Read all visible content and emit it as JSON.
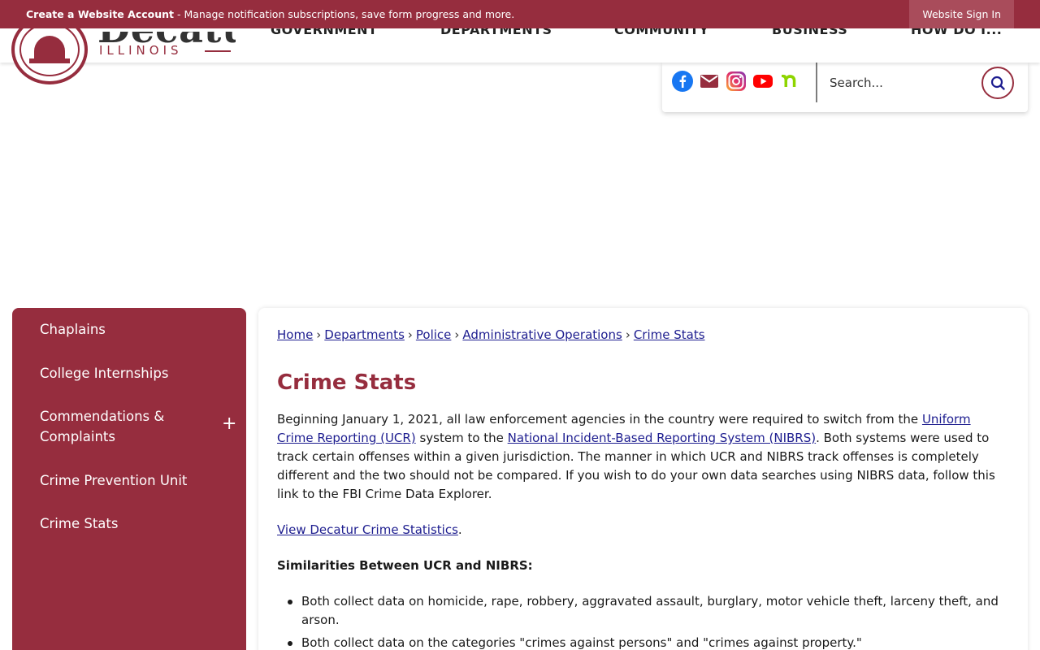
{
  "topbar": {
    "account_link": "Create a Website Account",
    "account_message": " - Manage notification subscriptions, save form progress and more.",
    "signin": "Website Sign In"
  },
  "logo": {
    "name": "Decatur",
    "subtitle": "ILLINOIS"
  },
  "nav": {
    "items": [
      "GOVERNMENT",
      "DEPARTMENTS",
      "COMMUNITY",
      "BUSINESS",
      "HOW DO I..."
    ]
  },
  "social": {
    "icons": [
      "facebook-icon",
      "email-icon",
      "instagram-icon",
      "youtube-icon",
      "nextdoor-icon"
    ],
    "colors": {
      "facebook": "#1877f2",
      "email": "#962d3e",
      "instagram": "#d6249f",
      "youtube": "#ff0000",
      "nextdoor": "#8ed500"
    }
  },
  "search": {
    "placeholder": "Search..."
  },
  "sidebar": {
    "items": [
      {
        "label": "Chaplains"
      },
      {
        "label": "College Internships"
      },
      {
        "label": "Commendations & Complaints"
      },
      {
        "label": "Crime Prevention Unit"
      },
      {
        "label": "Crime Stats"
      }
    ],
    "expand_symbol": "+"
  },
  "breadcrumb": [
    "Home",
    "Departments",
    "Police",
    "Administrative Operations",
    "Crime Stats"
  ],
  "page": {
    "title": "Crime Stats",
    "intro_1": "Beginning January 1, 2021, all law enforcement agencies in the country were required to switch from the ",
    "ucr_link": "Uniform Crime Reporting (UCR)",
    "intro_2": " system to the ",
    "nibrs_link": "National Incident-Based Reporting System (NIBRS)",
    "intro_3": ". Both systems were used to track certain offenses within a given jurisdiction. The manner in which UCR and NIBRS track offenses is completely different and the two should not be compared. If you wish to do your own data searches using NIBRS data, follow this link to the FBI Crime Data Explorer.",
    "view_link": "View Decatur Crime Statistics",
    "view_period": ".",
    "similarities_heading": "Similarities Between UCR and NIBRS:",
    "bullets": [
      "Both collect data on homicide, rape, robbery, aggravated assault, burglary, motor vehicle theft, larceny theft, and arson.",
      "Both collect data on the categories \"crimes against persons\" and \"crimes against property.\""
    ]
  },
  "colors": {
    "brand": "#962d3e",
    "link": "#1d1d8f"
  }
}
